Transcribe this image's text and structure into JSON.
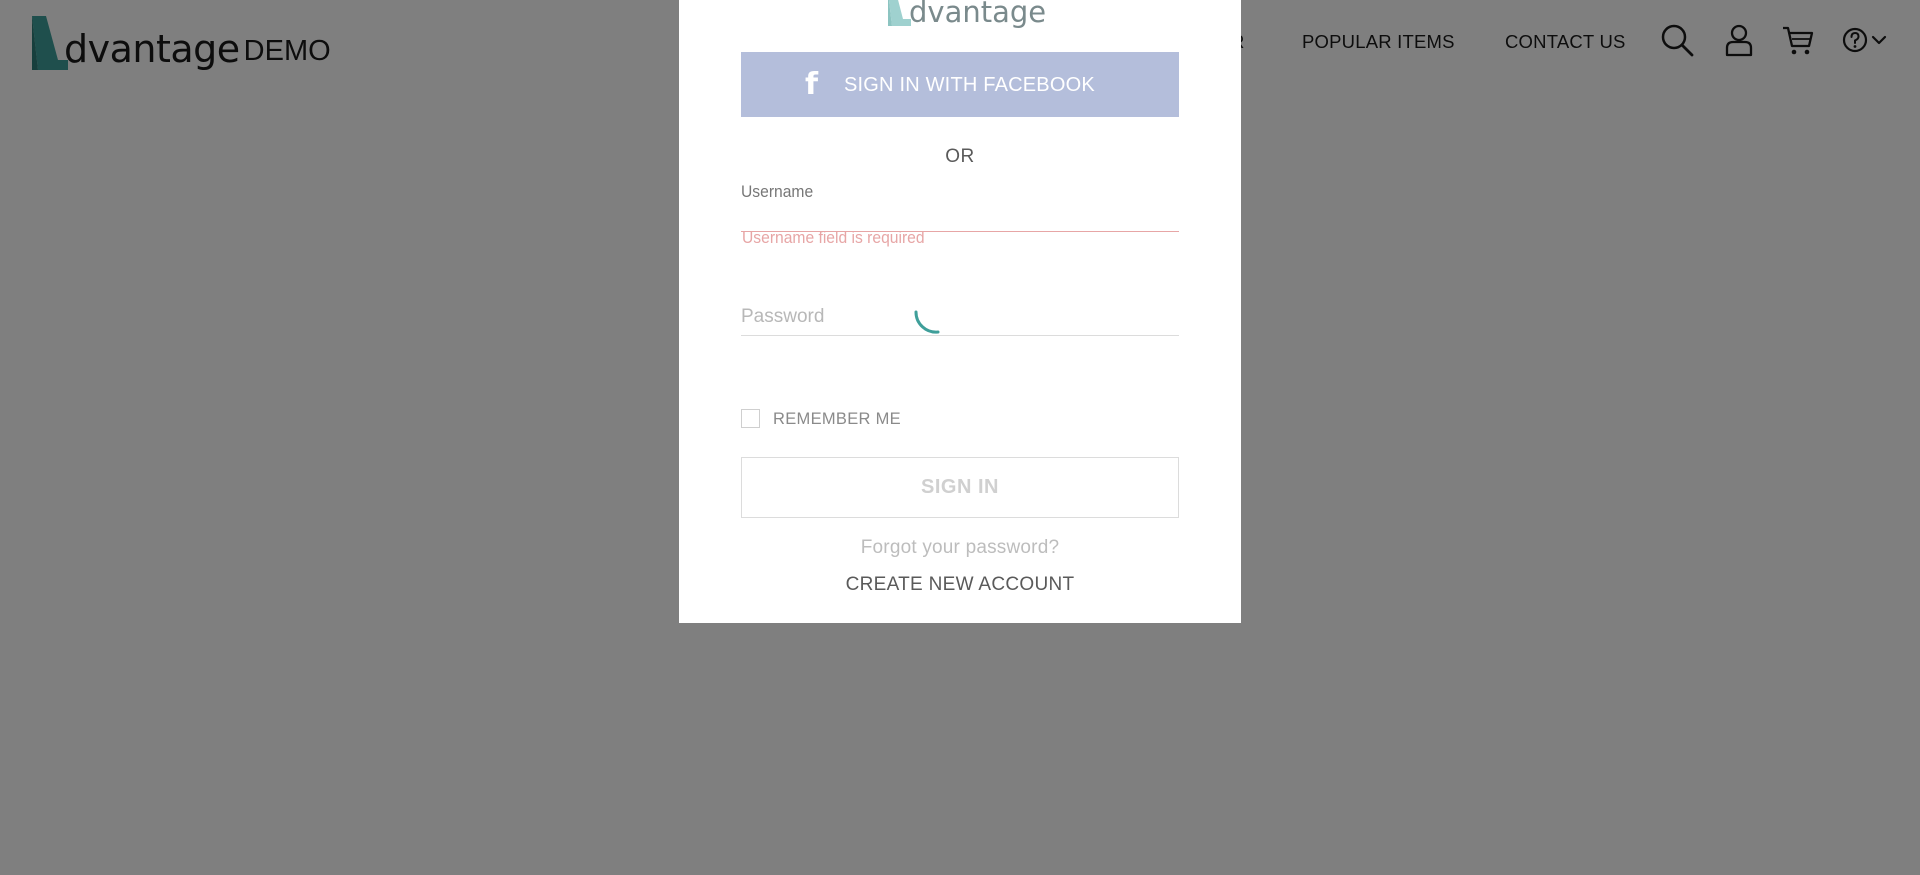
{
  "header": {
    "logo": {
      "word": "dvantage",
      "suffix": "DEMO"
    },
    "nav": {
      "partial_item": "R",
      "popular_items": "POPULAR ITEMS",
      "contact_us": "CONTACT US"
    },
    "icons": [
      "search-icon",
      "user-icon",
      "cart-icon",
      "help-icon",
      "chevron-down-icon"
    ]
  },
  "modal": {
    "logo_word": "dvantage",
    "facebook_button": "SIGN IN WITH FACEBOOK",
    "or_text": "OR",
    "username": {
      "label": "Username",
      "value": "",
      "error": "Username field is required"
    },
    "password": {
      "placeholder": "Password",
      "value": ""
    },
    "remember_me": {
      "label": "REMEMBER ME",
      "checked": false
    },
    "sign_in_button": "SIGN IN",
    "forgot_password": "Forgot your password?",
    "create_account": "CREATE NEW ACCOUNT"
  },
  "colors": {
    "brand_teal": "#3f9f9a",
    "facebook_button": "#b4bedb",
    "error": "#e7a6a6",
    "overlay": "rgba(0,0,0,0.5)"
  }
}
